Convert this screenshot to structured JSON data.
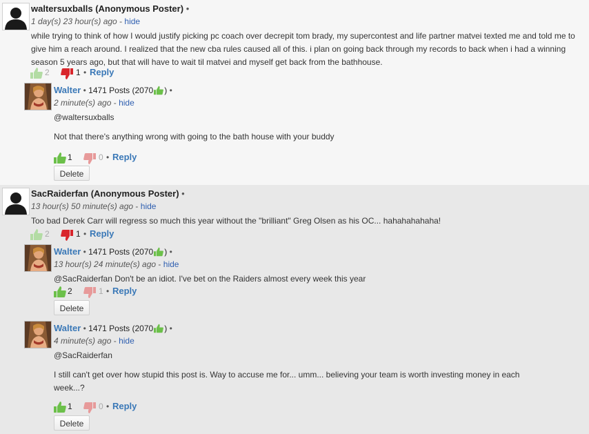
{
  "comments": [
    {
      "author": "waltersuxballs (Anonymous Poster)",
      "timestamp": "1 day(s) 23 hour(s) ago",
      "hide_label": "hide",
      "body": "while trying to think of how I would justify picking pc coach over decrepit tom brady, my supercontest and life partner matvei texted me and told me to give him a reach around. I realized that the new cba rules caused all of this. i plan on going back through my records to back when i had a winning season 5 years ago, but that will have to wait til matvei and myself get back from the bathhouse.",
      "up_votes": "2",
      "down_votes": "1",
      "reply_label": "Reply",
      "replies": [
        {
          "author": "Walter",
          "posts": "1471 Posts (2070",
          "timestamp": "2 minute(s) ago",
          "hide_label": "hide",
          "mention": "@waltersuxballs",
          "body": "Not that there's anything wrong with going to the bath house with your buddy",
          "up_votes": "1",
          "down_votes": "0",
          "reply_label": "Reply",
          "delete_label": "Delete"
        }
      ]
    },
    {
      "author": "SacRaiderfan (Anonymous Poster)",
      "timestamp": "13 hour(s) 50 minute(s) ago",
      "hide_label": "hide",
      "body": "Too bad Derek Carr will regress so much this year without the \"brilliant\" Greg Olsen as his OC... hahahahahaha!",
      "up_votes": "2",
      "down_votes": "1",
      "reply_label": "Reply",
      "replies": [
        {
          "author": "Walter",
          "posts": "1471 Posts (2070",
          "timestamp": "13 hour(s) 24 minute(s) ago",
          "hide_label": "hide",
          "body": "@SacRaiderfan Don't be an idiot. I've bet on the Raiders almost every week this year",
          "up_votes": "2",
          "down_votes": "1",
          "reply_label": "Reply",
          "delete_label": "Delete"
        },
        {
          "author": "Walter",
          "posts": "1471 Posts (2070",
          "timestamp": "4 minute(s) ago",
          "hide_label": "hide",
          "mention": "@SacRaiderfan",
          "body": "I still can't get over how stupid this post is. Way to accuse me for... umm... believing your team is worth investing money in each week...?",
          "up_votes": "1",
          "down_votes": "0",
          "reply_label": "Reply",
          "delete_label": "Delete"
        }
      ]
    }
  ],
  "colors": {
    "thumb_up_green": "#6cc04a",
    "thumb_down_red": "#d9262c",
    "thumb_down_faded": "#e79a9a",
    "link_blue": "#3a78b7"
  },
  "icons": {
    "anon_avatar": "silhouette-avatar-icon",
    "user_avatar": "user-photo-avatar",
    "upvote": "thumbs-up-icon",
    "downvote": "thumbs-down-icon"
  }
}
